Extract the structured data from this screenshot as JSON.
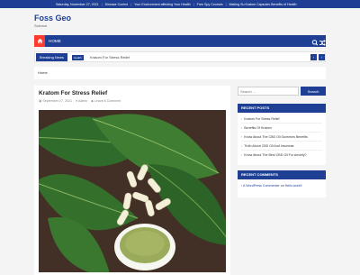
{
  "topbar": {
    "date": "Saturday, November 27, 2021",
    "links": [
      "Disease Control",
      "Your Environment affecting Your Health",
      "Free Spy Courses",
      "Making Su Kratom Capsules Benefits of Health"
    ]
  },
  "site": {
    "title": "Foss Geo",
    "tagline": "Science"
  },
  "nav": {
    "home": "HOME"
  },
  "ticker": {
    "label": "Breaking News",
    "tag": "Health",
    "headline": "Kratom For Stress Relief",
    "prev": "‹",
    "next": "›"
  },
  "breadcrumb": {
    "home": "Home"
  },
  "post": {
    "title": "Kratom For Stress Relief",
    "date": "September 27, 2021",
    "author": "Admin",
    "comments": "Leave A Comment"
  },
  "search": {
    "placeholder": "Search ...",
    "button": "Search"
  },
  "recent_posts": {
    "heading": "RECENT POSTS",
    "items": [
      "Kratom For Stress Relief",
      "Benefits Of Kratom",
      "Know About The CBD Oil Gummies Benefits",
      "Truth About CBD Oil And Insomnia",
      "Know About The Best CBD Oil For Anxiety?"
    ]
  },
  "recent_comments": {
    "heading": "RECENT COMMENTS",
    "author": "A WordPress Commenter",
    "on": "on",
    "post": "Hello world!"
  },
  "colors": {
    "brand": "#1e3f93",
    "accent": "#ff3b30"
  }
}
